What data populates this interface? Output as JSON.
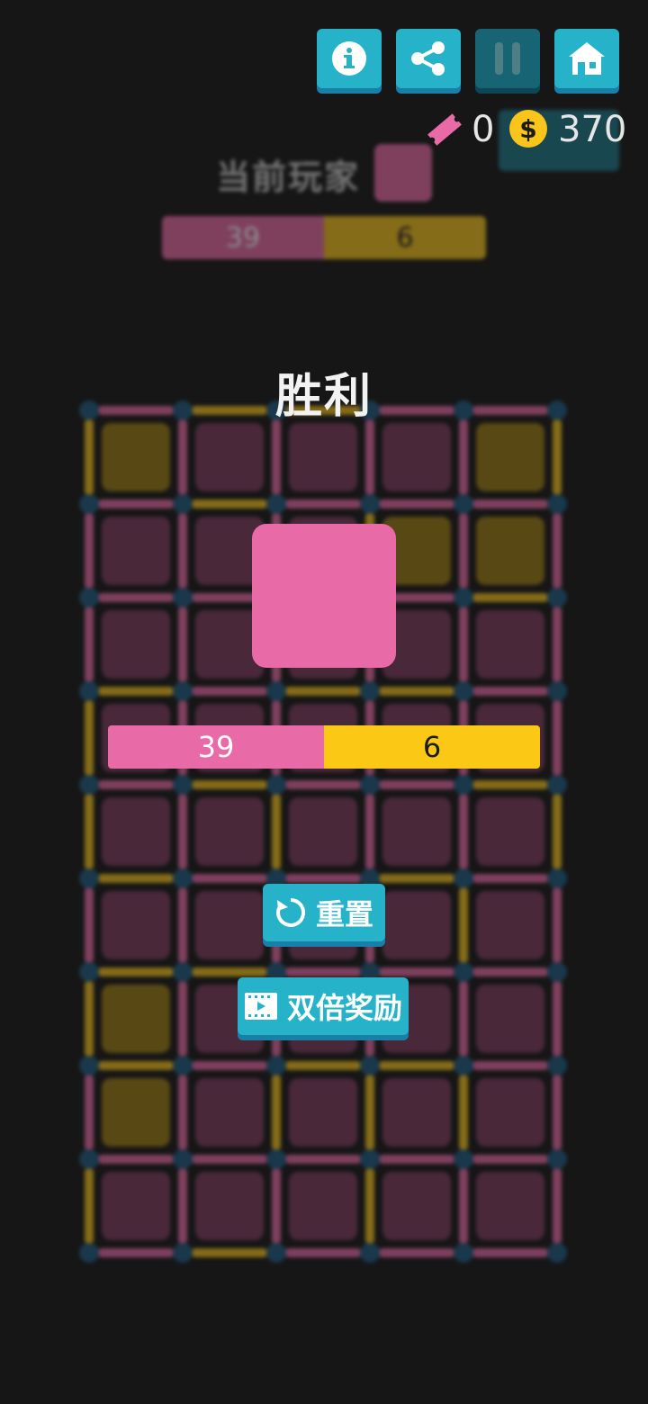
{
  "toolbar": {
    "buttons": [
      {
        "name": "info-button",
        "icon": "info-icon"
      },
      {
        "name": "share-button",
        "icon": "share-icon"
      },
      {
        "name": "pause-button",
        "icon": "pause-icon"
      },
      {
        "name": "home-button",
        "icon": "home-icon"
      }
    ]
  },
  "currency": {
    "tickets": "0",
    "coin_symbol": "$",
    "coins": "370"
  },
  "status": {
    "current_player_label": "当前玩家",
    "score_pink": "39",
    "score_yellow": "6"
  },
  "result": {
    "title": "胜利",
    "score_pink": "39",
    "score_yellow": "6",
    "reset_label": "重置",
    "double_reward_label": "双倍奖励"
  },
  "colors": {
    "pink": "#e86aa6",
    "yellow": "#f2c11a",
    "pink_dim": "#7c3a5e",
    "yellow_dim": "#9a7a12",
    "dot": "#1d5b80",
    "accent": "#26b3c9"
  },
  "board": {
    "cols": 5,
    "rows": 9,
    "cells": [
      [
        "Y",
        "P",
        "P",
        "P",
        "Y"
      ],
      [
        "P",
        "P",
        "P",
        "Y",
        "Y"
      ],
      [
        "P",
        "P",
        "P",
        "P",
        "P"
      ],
      [
        "P",
        "P",
        "P",
        "P",
        "P"
      ],
      [
        "P",
        "P",
        "P",
        "P",
        "P"
      ],
      [
        "P",
        "P",
        "P",
        "P",
        "P"
      ],
      [
        "Y",
        "P",
        "P",
        "P",
        "P"
      ],
      [
        "Y",
        "P",
        "P",
        "P",
        "P"
      ],
      [
        "P",
        "P",
        "P",
        "P",
        "P"
      ]
    ],
    "h_edges": [
      [
        "P",
        "Y",
        "Y",
        "P",
        "P"
      ],
      [
        "P",
        "Y",
        "P",
        "P",
        "P"
      ],
      [
        "P",
        "P",
        "P",
        "P",
        "Y"
      ],
      [
        "Y",
        "P",
        "Y",
        "Y",
        "P"
      ],
      [
        "P",
        "Y",
        "P",
        "P",
        "Y"
      ],
      [
        "Y",
        "P",
        "P",
        "Y",
        "P"
      ],
      [
        "Y",
        "Y",
        "P",
        "P",
        "P"
      ],
      [
        "Y",
        "P",
        "Y",
        "Y",
        "P"
      ],
      [
        "P",
        "P",
        "P",
        "P",
        "P"
      ],
      [
        "P",
        "Y",
        "P",
        "P",
        "P"
      ]
    ],
    "v_edges": [
      [
        "Y",
        "P",
        "P",
        "P",
        "P",
        "Y"
      ],
      [
        "P",
        "P",
        "P",
        "Y",
        "P",
        "P"
      ],
      [
        "P",
        "P",
        "P",
        "P",
        "P",
        "P"
      ],
      [
        "Y",
        "P",
        "P",
        "P",
        "P",
        "P"
      ],
      [
        "Y",
        "P",
        "Y",
        "P",
        "P",
        "Y"
      ],
      [
        "P",
        "P",
        "P",
        "P",
        "Y",
        "P"
      ],
      [
        "Y",
        "P",
        "P",
        "P",
        "P",
        "P"
      ],
      [
        "P",
        "P",
        "Y",
        "Y",
        "Y",
        "P"
      ],
      [
        "Y",
        "P",
        "P",
        "Y",
        "P",
        "P"
      ]
    ]
  }
}
